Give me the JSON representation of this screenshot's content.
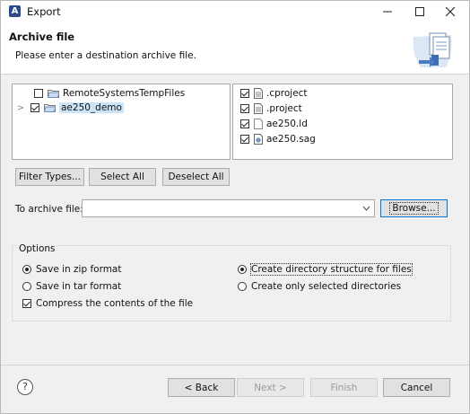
{
  "window": {
    "title": "Export",
    "app_icon_letter": "A"
  },
  "header": {
    "title": "Archive file",
    "description": "Please enter a destination archive file."
  },
  "left_tree": [
    {
      "label": "RemoteSystemsTempFiles",
      "checked": false,
      "expandable": false,
      "selected": false
    },
    {
      "label": "ae250_demo",
      "checked": true,
      "expandable": true,
      "selected": true
    }
  ],
  "right_files": [
    {
      "label": ".cproject",
      "checked": true
    },
    {
      "label": ".project",
      "checked": true
    },
    {
      "label": "ae250.ld",
      "checked": true
    },
    {
      "label": "ae250.sag",
      "checked": true
    }
  ],
  "selection_buttons": {
    "filter": "Filter Types...",
    "select_all": "Select All",
    "deselect_all": "Deselect All"
  },
  "destination": {
    "label": "To archive file:",
    "value": "",
    "browse": "Browse..."
  },
  "options": {
    "group_label": "Options",
    "zip": "Save in zip format",
    "tar": "Save in tar format",
    "compress": "Compress the contents of the file",
    "dir_structure": "Create directory structure for files",
    "only_selected": "Create only selected directories"
  },
  "footer": {
    "back": "< Back",
    "next": "Next >",
    "finish": "Finish",
    "cancel": "Cancel",
    "help": "?"
  },
  "colors": {
    "selection": "#cce4f7",
    "focus_border": "#0078d7",
    "dialog_bg": "#f0f0f0"
  }
}
